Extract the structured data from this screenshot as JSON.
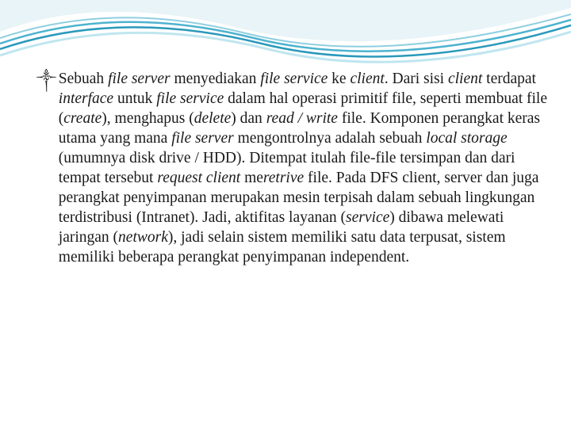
{
  "slide": {
    "bullet_glyph": "༒",
    "segments": {
      "s00": "Sebuah ",
      "s01": "file server",
      "s02": " menyediakan ",
      "s03": "file service",
      "s04": " ke ",
      "s05": "client",
      "s06": ". Dari sisi ",
      "s07": "client",
      "s08": " terdapat ",
      "s09": "interface",
      "s10": " untuk ",
      "s11": "file service",
      "s12": " dalam hal operasi primitif file, seperti membuat file (",
      "s13": "create",
      "s14": "), menghapus (",
      "s15": "delete",
      "s16": ") dan ",
      "s17": "read / write",
      "s18": " file. Komponen perangkat keras utama yang mana ",
      "s19": "file server",
      "s20": " mengontrolnya adalah sebuah ",
      "s21": "local storage",
      "s22": " (umumnya disk drive / HDD). Ditempat itulah file-file tersimpan dan dari tempat tersebut ",
      "s23": "request client",
      "s24": " me",
      "s25": "retrive",
      "s26": " file. Pada DFS client, server dan juga perangkat penyimpanan merupakan mesin terpisah dalam sebuah lingkungan terdistribusi (Intranet). Jadi, aktifitas layanan (",
      "s27": "service",
      "s28": ") dibawa melewati jaringan (",
      "s29": "network",
      "s30": "), jadi selain sistem memiliki satu data terpusat, sistem memiliki beberapa perangkat penyimpanan independent."
    }
  }
}
